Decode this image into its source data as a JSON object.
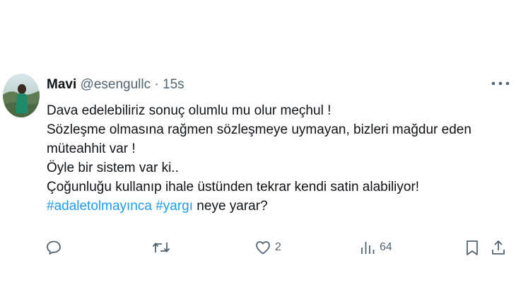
{
  "tweet": {
    "display_name": "Mavi",
    "handle": "@esengullc",
    "separator": "·",
    "time": "15s",
    "lines": [
      "Dava edelebiliriz sonuç olumlu mu olur meçhul !",
      "Sözleşme olmasına rağmen sözleşmeye uymayan, bizleri mağdur eden",
      "müteahhit var !",
      "Öyle bir sistem var ki..",
      "Çoğunluğu kullanıp ihale üstünden tekrar kendi satin alabiliyor!"
    ],
    "hashtag_1": "#adaletolmayınca",
    "hashtag_2": "#yargı",
    "last_line_tail": " neye yarar?"
  },
  "actions": {
    "reply_count": "",
    "retweet_count": "",
    "like_count": "2",
    "views_count": "64"
  },
  "colors": {
    "text": "#0f1419",
    "muted": "#536471",
    "hashtag": "#1d9bf0"
  },
  "icons": [
    "avatar-photo",
    "more-icon",
    "reply-icon",
    "retweet-icon",
    "like-icon",
    "views-icon",
    "bookmark-icon",
    "share-icon"
  ]
}
